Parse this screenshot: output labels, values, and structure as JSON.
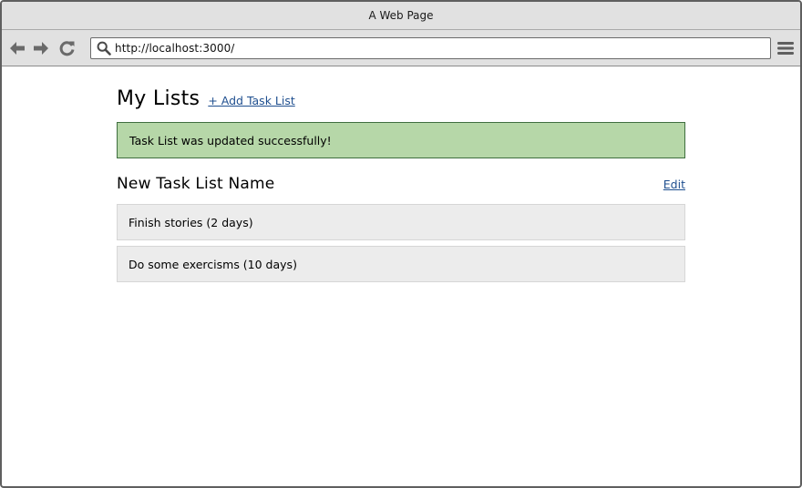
{
  "window": {
    "title": "A Web Page"
  },
  "browser": {
    "url": "http://localhost:3000/"
  },
  "page": {
    "title": "My Lists",
    "add_link": "+ Add Task List",
    "flash_message": "Task List was updated successfully!",
    "list": {
      "name": "New Task List Name",
      "edit_label": "Edit",
      "tasks": [
        {
          "label": "Finish stories (2 days)"
        },
        {
          "label": "Do some exercisms (10 days)"
        }
      ]
    }
  },
  "colors": {
    "flash_bg": "#b6d7a8",
    "link": "#1f4f8f",
    "task_bg": "#ececec",
    "chrome": "#e1e1e1"
  },
  "icons": [
    "back-arrow-icon",
    "forward-arrow-icon",
    "reload-icon",
    "search-icon",
    "hamburger-menu-icon"
  ]
}
